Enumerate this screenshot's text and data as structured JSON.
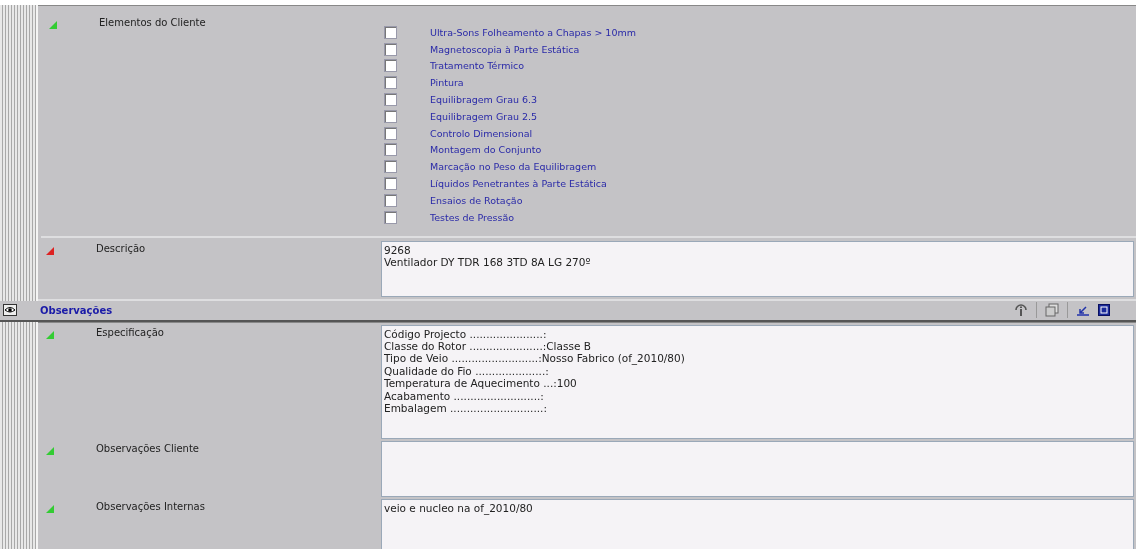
{
  "top_fields": [
    {
      "label": "Elementos do Cliente",
      "kind": "checklist",
      "color": "#33cc33",
      "options": [
        {
          "label": "Ultra-Sons Folheamento a Chapas > 10mm",
          "checked": false
        },
        {
          "label": "Magnetoscopia à Parte Estática",
          "checked": false
        },
        {
          "label": "Tratamento Térmico",
          "checked": false
        },
        {
          "label": "Pintura",
          "checked": false
        },
        {
          "label": "Equilibragem Grau 6.3",
          "checked": false
        },
        {
          "label": "Equilibragem Grau 2.5",
          "checked": false
        },
        {
          "label": "Controlo Dimensional",
          "checked": false
        },
        {
          "label": "Montagem do Conjunto",
          "checked": false
        },
        {
          "label": "Marcação no Peso da Equilibragem",
          "checked": false
        },
        {
          "label": "Líquidos Penetrantes à Parte Estática",
          "checked": false
        },
        {
          "label": "Ensaios de Rotação",
          "checked": false
        },
        {
          "label": "Testes de Pressão",
          "checked": false
        }
      ]
    },
    {
      "label": "Descrição",
      "kind": "text",
      "color": "#dd2222",
      "value": "9268\nVentilador DY TDR 168 3TD 8A LG 270º"
    }
  ],
  "section": {
    "title": "Observações"
  },
  "section_fields": [
    {
      "label": "Especificação",
      "kind": "text",
      "color": "#33cc33",
      "value": "Código Projecto ......................:\nClasse do Rotor ......................:Classe B\nTipo de Veio ..........................:Nosso Fabrico (of_2010/80)\nQualidade do Fio .....................:\nTemperatura de Aquecimento ...:100\nAcabamento ..........................:\nEmbalagem ............................:"
    },
    {
      "label": "Observações Cliente",
      "kind": "text",
      "color": "#33cc33"
    },
    {
      "label": "Observações Internas",
      "kind": "text",
      "color": "#33cc33",
      "value": "veio e nucleo na of_2010/80"
    }
  ]
}
